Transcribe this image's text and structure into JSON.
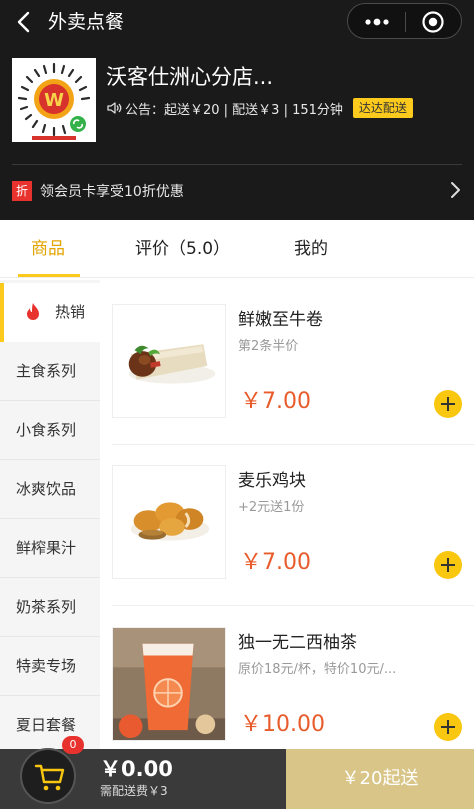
{
  "header": {
    "title": "外卖点餐",
    "back_icon": "chevron-left-icon",
    "more_icon": "more-dots-icon",
    "close_icon": "target-icon"
  },
  "store": {
    "name": "沃客仕洲心分店...",
    "logo_icon": "mini-program-code-logo",
    "notice": "公告：起送￥20 | 配送￥3 | 151分钟",
    "delivery_badge": "达达配送",
    "member_badge": "折",
    "member_text": "领会员卡享受10折优惠"
  },
  "tabs": [
    {
      "label": "商品",
      "active": true
    },
    {
      "label": "评价（5.0）",
      "active": false
    },
    {
      "label": "我的",
      "active": false
    }
  ],
  "categories": [
    {
      "label": "热销",
      "active": true,
      "icon": "flame-icon"
    },
    {
      "label": "主食系列"
    },
    {
      "label": "小食系列"
    },
    {
      "label": "冰爽饮品"
    },
    {
      "label": "鲜榨果汁"
    },
    {
      "label": "奶茶系列"
    },
    {
      "label": "特卖专场"
    },
    {
      "label": "夏日套餐"
    }
  ],
  "products": [
    {
      "name": "鲜嫩至牛卷",
      "desc": "第2条半价",
      "price": "￥7.00"
    },
    {
      "name": "麦乐鸡块",
      "desc": "+2元送1份",
      "price": "￥7.00"
    },
    {
      "name": "独一无二西柚茶",
      "desc": "原价18元/杯，特价10元/...",
      "price": "￥10.00"
    }
  ],
  "cart": {
    "count": "0",
    "total": "￥0.00",
    "fee": "需配送费￥3",
    "checkout_label": "￥20起送"
  },
  "colors": {
    "header_bg": "#1a1a1a",
    "accent_yellow": "#fcca1c",
    "price_red": "#e85c2c",
    "checkout_bg": "#d8c587"
  }
}
